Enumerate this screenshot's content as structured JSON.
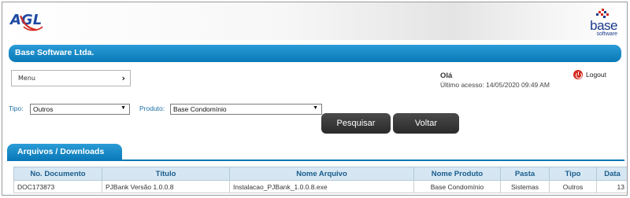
{
  "header": {
    "agl_logo_text": "AGL",
    "base_logo_word": "base",
    "base_logo_sub": "software"
  },
  "company_name": "Base Software Ltda.",
  "menu": {
    "label": "Menu",
    "chevron": "›"
  },
  "user": {
    "greeting": "Olá",
    "last_access": "Último acesso: 14/05/2020  09:49 AM",
    "logout_label": "Logout"
  },
  "filters": {
    "tipo_label": "Tipo:",
    "tipo_value": "Outros",
    "produto_label": "Produto:",
    "produto_value": "Base Condomínio",
    "arrow": "▼"
  },
  "buttons": {
    "search": "Pesquisar",
    "back": "Voltar"
  },
  "tab": {
    "label": "Arquivos / Downloads"
  },
  "table": {
    "columns": [
      "No. Documento",
      "Título",
      "Nome Arquivo",
      "Nome Produto",
      "Pasta",
      "Tipo",
      "Data"
    ],
    "rows": [
      [
        "DOC173873",
        "PJBank Versão 1.0.0.8",
        "Instalacao_PJBank_1.0.0.8.exe",
        "Base Condomínio",
        "Sistemas",
        "Outros",
        "13"
      ]
    ]
  },
  "colors": {
    "accent_blue": "#0a78b8",
    "header_cell_bg": "#d6e7f3",
    "button_dark": "#333333",
    "logout_red": "#d42a20"
  },
  "icons": {
    "logout": "power-icon",
    "menu_expand": "chevron-right-icon",
    "dropdown": "caret-down-icon"
  }
}
